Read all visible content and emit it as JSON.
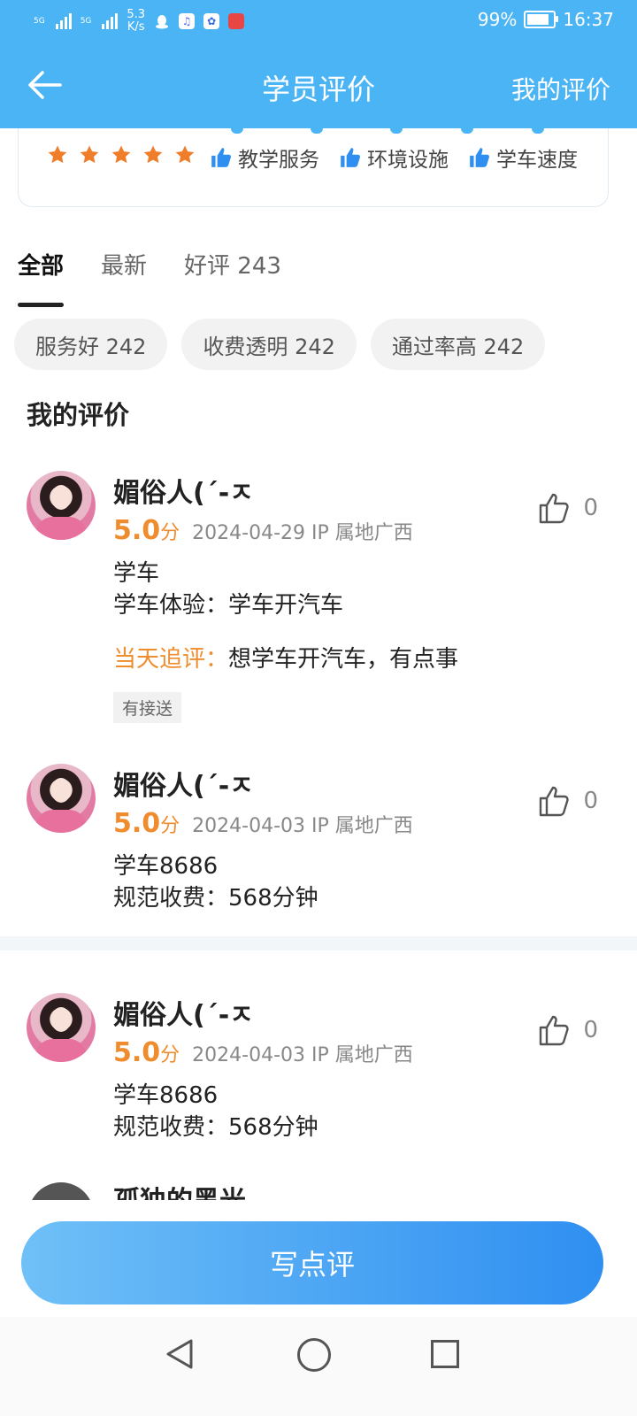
{
  "status_bar": {
    "network_labels": [
      "5G",
      "5G"
    ],
    "speed": "5.3\nK/s",
    "battery": "99%",
    "battery_level": 0.99,
    "time": "16:37"
  },
  "header": {
    "title": "学员评价",
    "right_link": "我的评价"
  },
  "rating_card": {
    "stars": 5,
    "star_color": "#f07d2a",
    "tags": [
      "教学服务",
      "环境设施",
      "学车速度"
    ]
  },
  "tabs": [
    {
      "label": "全部",
      "active": true
    },
    {
      "label": "最新",
      "active": false
    },
    {
      "label": "好评 243",
      "active": false
    }
  ],
  "chips": [
    "服务好 242",
    "收费透明 242",
    "通过率高 242"
  ],
  "section_title": "我的评价",
  "reviews": [
    {
      "name": "媚俗人(´-ㅈ",
      "score": "5.0",
      "unit": "分",
      "date": "2024-04-29  IP 属地广西",
      "likes": "0",
      "lines": [
        "学车",
        "学车体验：学车开汽车"
      ],
      "followup_label": "当天追评：",
      "followup_text": "想学车开汽车，有点事",
      "tag": "有接送"
    },
    {
      "name": "媚俗人(´-ㅈ",
      "score": "5.0",
      "unit": "分",
      "date": "2024-04-03  IP 属地广西",
      "likes": "0",
      "lines": [
        "学车8686",
        "规范收费：568分钟"
      ]
    },
    {
      "name": "媚俗人(´-ㅈ",
      "score": "5.0",
      "unit": "分",
      "date": "2024-04-03  IP 属地广西",
      "likes": "0",
      "lines": [
        "学车8686",
        "规范收费：568分钟"
      ]
    }
  ],
  "partial_review_name": "孤独的黑光",
  "write_button": "写点评",
  "colors": {
    "primary": "#4ab4f5",
    "accent": "#ef8c2d",
    "button_gradient": [
      "#6fc0f7",
      "#2f8ff1"
    ]
  }
}
